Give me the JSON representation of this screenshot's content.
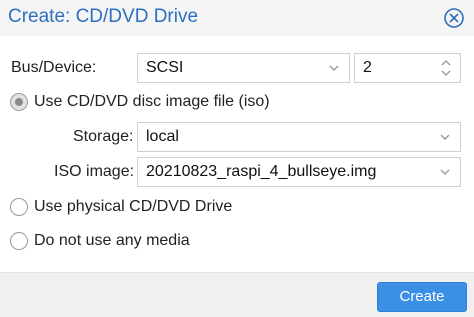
{
  "dialog": {
    "title": "Create: CD/DVD Drive"
  },
  "bus_device": {
    "label": "Bus/Device:",
    "bus_value": "SCSI",
    "device_value": "2"
  },
  "options": {
    "use_iso": {
      "label": "Use CD/DVD disc image file (iso)",
      "checked": true
    },
    "use_physical": {
      "label": "Use physical CD/DVD Drive",
      "checked": false
    },
    "no_media": {
      "label": "Do not use any media",
      "checked": false
    }
  },
  "storage": {
    "label": "Storage:",
    "value": "local"
  },
  "iso_image": {
    "label": "ISO image:",
    "value": "20210823_raspi_4_bullseye.img"
  },
  "footer": {
    "create_label": "Create"
  },
  "colors": {
    "title": "#2d6fbf",
    "button": "#3b8fe4"
  },
  "icons": {
    "close": "close-circle-icon",
    "dropdown": "chevron-down-icon",
    "spinner": "spinner-arrows-icon"
  }
}
